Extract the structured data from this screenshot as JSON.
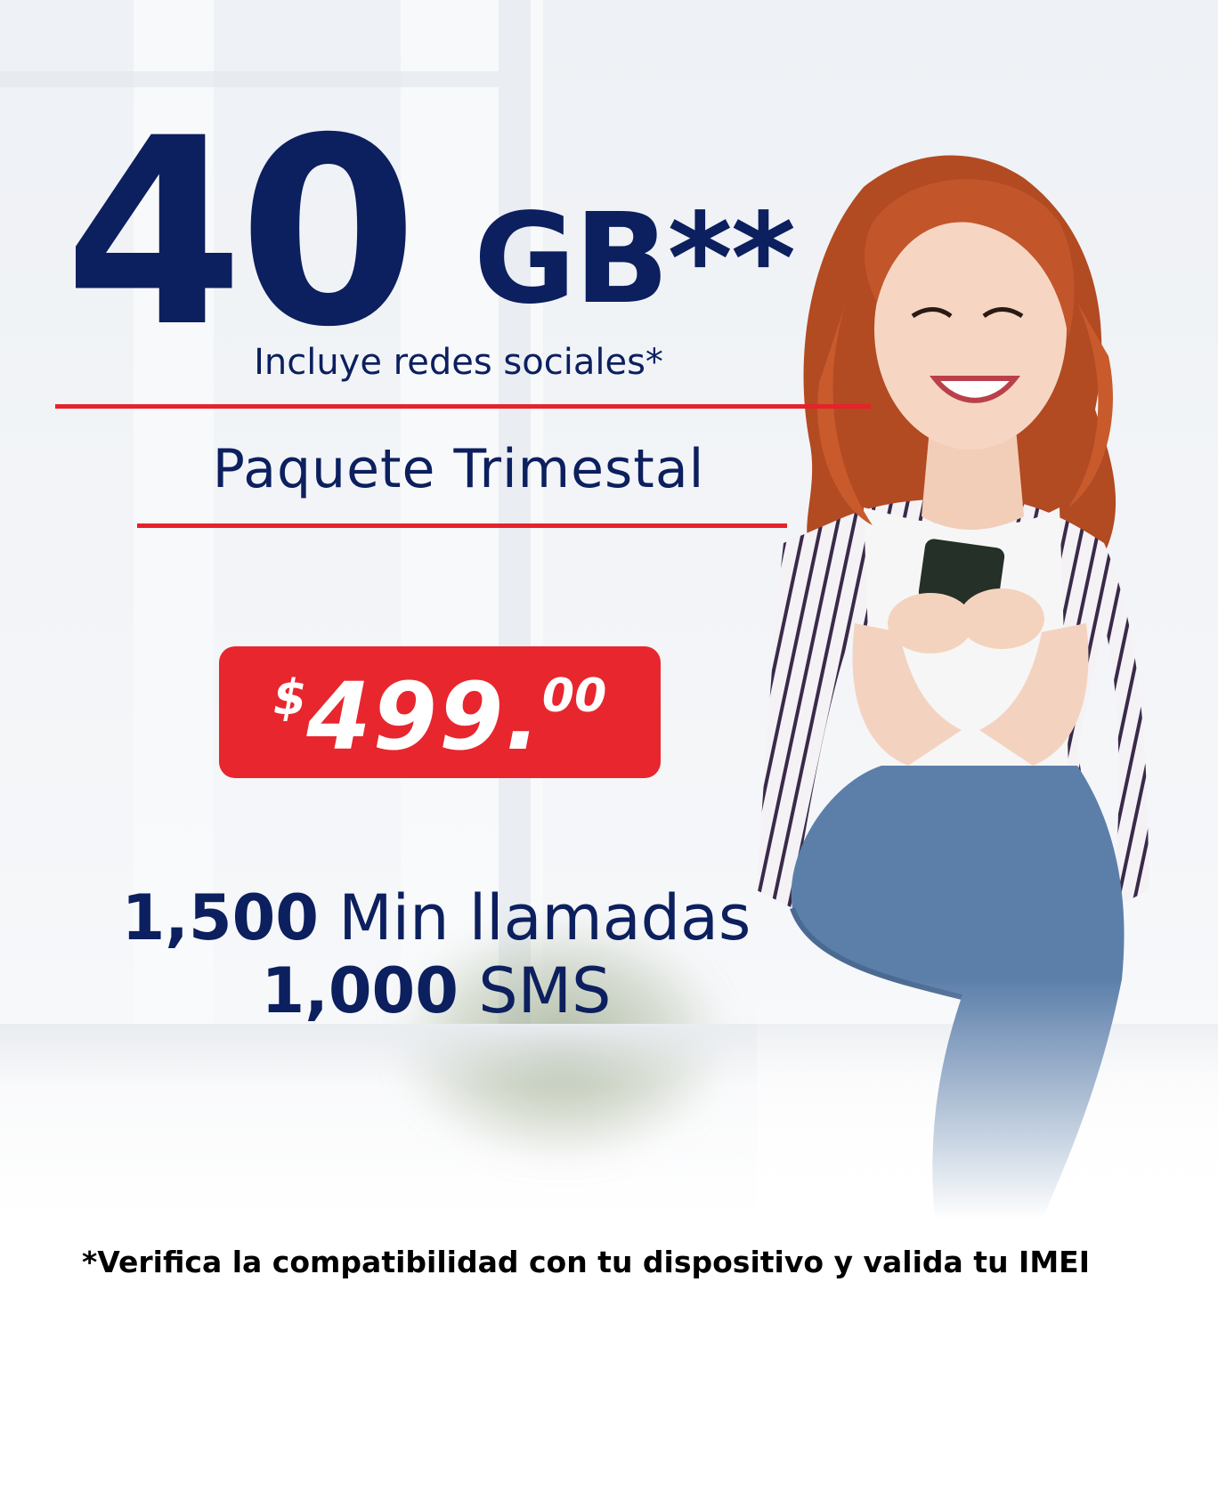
{
  "headline": {
    "amount": "40",
    "unit": "GB**",
    "subtitle": "Incluye redes sociales*"
  },
  "package": {
    "name": "Paquete Trimestal"
  },
  "price": {
    "currency": "$",
    "amount": "499.",
    "cents": "00"
  },
  "features": [
    {
      "value": "1,500",
      "label": "Min llamadas"
    },
    {
      "value": "1,000",
      "label": "SMS"
    }
  ],
  "footnote": "*Verifica la compatibilidad con tu dispositivo y valida tu IMEI",
  "colors": {
    "navy": "#0c1f5e",
    "red": "#e8262e",
    "white": "#ffffff"
  },
  "image": {
    "subject": "woman-with-smartphone"
  }
}
